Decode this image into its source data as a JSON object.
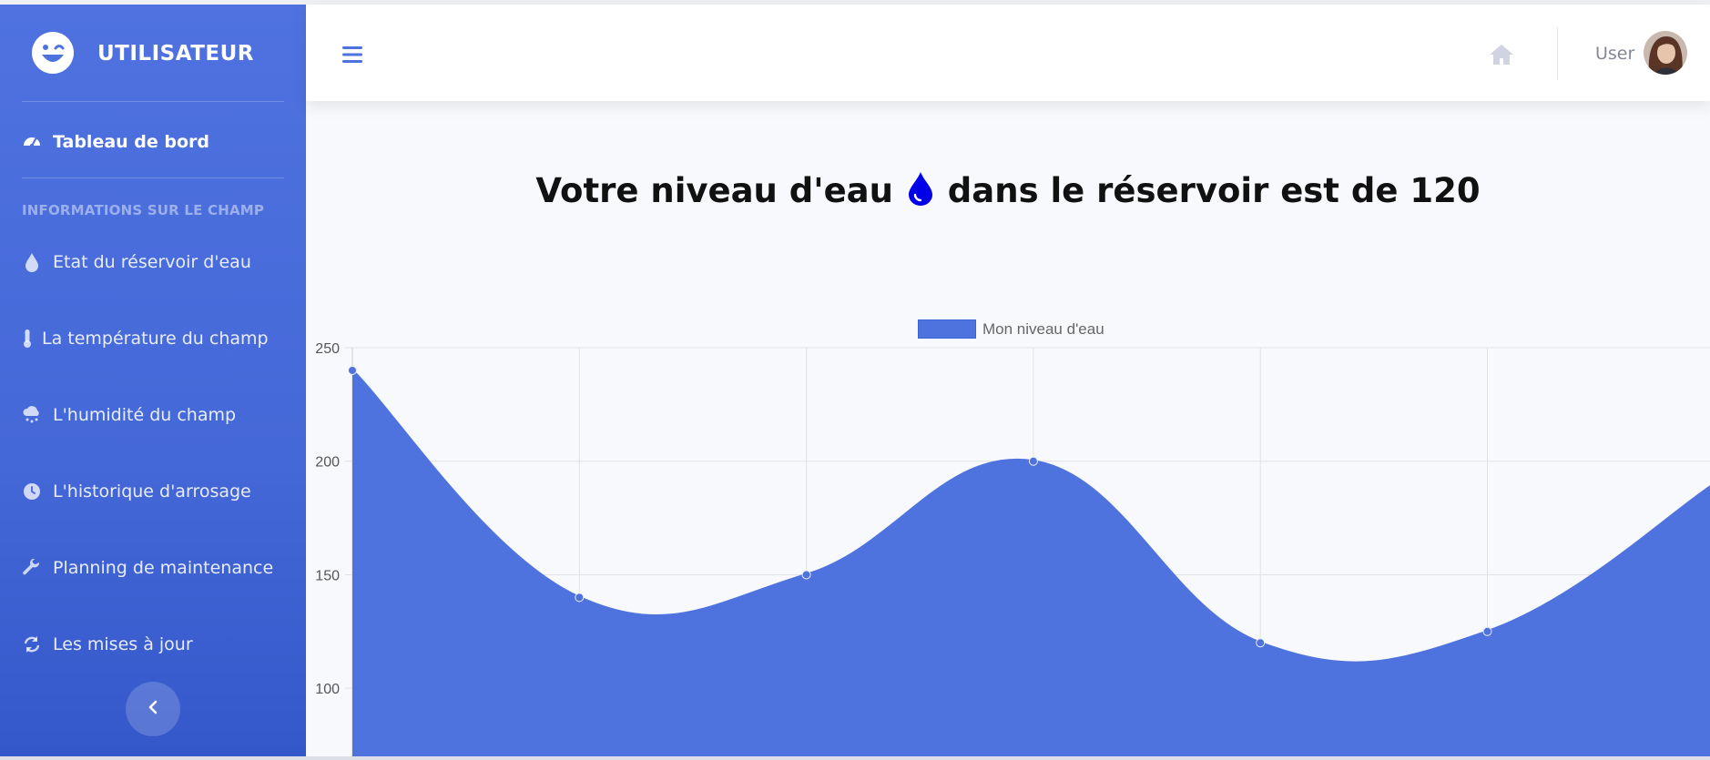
{
  "brand": {
    "name": "UTILISATEUR",
    "icon": "laugh-wink-icon"
  },
  "sidebar": {
    "dashboard": {
      "label": "Tableau de bord",
      "icon": "tachometer-icon"
    },
    "section_heading": "INFORMATIONS SUR LE CHAMP",
    "items": [
      {
        "label": "Etat du réservoir d'eau",
        "icon": "tint-icon"
      },
      {
        "label": "La température du champ",
        "icon": "thermometer-icon"
      },
      {
        "label": "L'humidité du champ",
        "icon": "cloud-rain-icon"
      },
      {
        "label": "L'historique d'arrosage",
        "icon": "clock-icon"
      },
      {
        "label": "Planning de maintenance",
        "icon": "wrench-icon"
      },
      {
        "label": "Les mises à jour",
        "icon": "sync-icon"
      }
    ],
    "collapse_icon": "chevron-left-icon"
  },
  "topbar": {
    "menu_icon": "bars-icon",
    "home_icon": "home-icon",
    "user_label": "User"
  },
  "main": {
    "headline_before": "Votre niveau d'eau",
    "headline_after": "dans le réservoir est de 120"
  },
  "colors": {
    "sidebar_top": "#4f72e0",
    "sidebar_bottom": "#3458ca",
    "area_fill": "#4e73df",
    "drop": "#0000e6"
  },
  "chart_data": {
    "type": "area",
    "legend": [
      "Mon niveau d'eau"
    ],
    "legend_position": "top-center",
    "series": [
      {
        "name": "Mon niveau d'eau",
        "values": [
          240,
          140,
          150,
          200,
          120,
          125,
          190
        ]
      }
    ],
    "yticks": [
      100,
      150,
      200,
      250
    ],
    "ylim": [
      70,
      250
    ],
    "grid": true,
    "curve": "smooth"
  }
}
